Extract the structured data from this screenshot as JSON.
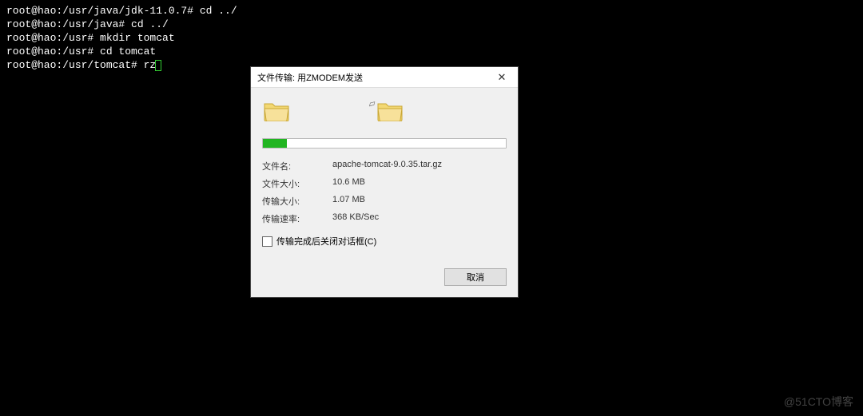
{
  "terminal": {
    "lines": [
      {
        "prompt": "root@hao:/usr/java/jdk-11.0.7#",
        "cmd": " cd ../"
      },
      {
        "prompt": "root@hao:/usr/java#",
        "cmd": " cd ../"
      },
      {
        "prompt": "root@hao:/usr#",
        "cmd": " mkdir tomcat"
      },
      {
        "prompt": "root@hao:/usr#",
        "cmd": " cd tomcat"
      },
      {
        "prompt": "root@hao:/usr/tomcat#",
        "cmd": " rz"
      }
    ]
  },
  "dialog": {
    "title": "文件传输: 用ZMODEM发送",
    "close_glyph": "✕",
    "progress_percent": 10,
    "fields": {
      "filename_label": "文件名:",
      "filename_value": "apache-tomcat-9.0.35.tar.gz",
      "filesize_label": "文件大小:",
      "filesize_value": "10.6 MB",
      "transfersize_label": "传输大小:",
      "transfersize_value": "1.07 MB",
      "speed_label": "传输速率:",
      "speed_value": "368 KB/Sec"
    },
    "checkbox_label": "传输完成后关闭对话框(C)",
    "checkbox_checked": false,
    "cancel_label": "取消"
  },
  "watermark": "@51CTO博客"
}
